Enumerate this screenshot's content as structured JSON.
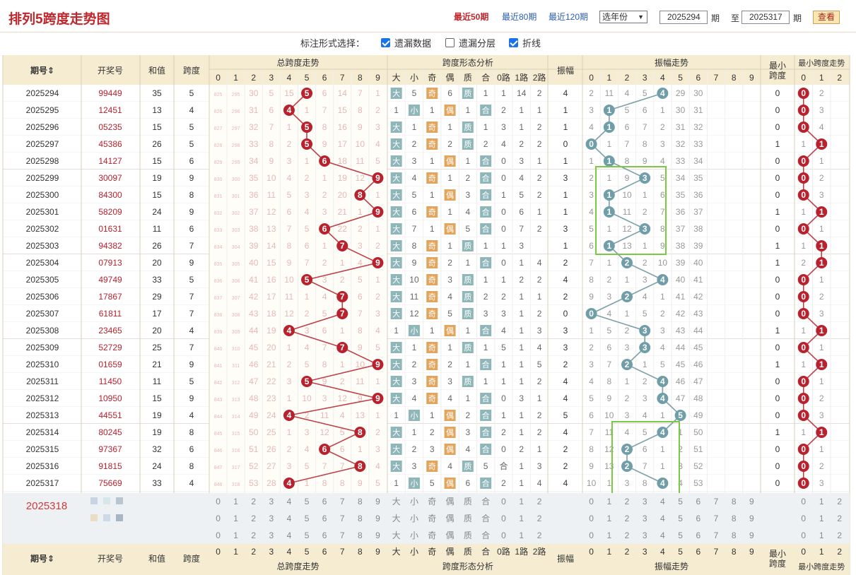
{
  "header": {
    "title": "排列5跨度走势图",
    "ranges": [
      {
        "label": "最近50期",
        "active": true
      },
      {
        "label": "最近80期",
        "active": false
      },
      {
        "label": "最近120期",
        "active": false
      }
    ],
    "year_select": "选年份",
    "from_issue": "2025294",
    "period_label": "期",
    "to_label": "至",
    "to_issue": "2025317",
    "period_label2": "期",
    "search_button": "查看"
  },
  "options": {
    "label": "标注形式选择：",
    "items": [
      {
        "label": "遗漏数据",
        "checked": true
      },
      {
        "label": "遗漏分层",
        "checked": false
      },
      {
        "label": "折线",
        "checked": true
      }
    ]
  },
  "columns": {
    "issue": "期号",
    "draw": "开奖号",
    "sum": "和值",
    "span": "跨度",
    "span_trend": "总跨度走势",
    "form": "跨度形态分析",
    "amp": "振幅",
    "amp_trend": "振幅走势",
    "minspan": "最小跨度",
    "minspan_trend": "最小跨度走势",
    "digits": [
      "0",
      "1",
      "2",
      "3",
      "4",
      "5",
      "6",
      "7",
      "8",
      "9"
    ],
    "form_sub": [
      "大",
      "小",
      "奇",
      "偶",
      "质",
      "合",
      "0路",
      "1路",
      "2路"
    ],
    "min_digits": [
      "0",
      "1",
      "2"
    ]
  },
  "rows": [
    {
      "issue": "2025294",
      "draw": "99449",
      "sum": 35,
      "span": 5,
      "amp": 4,
      "min": 0,
      "miss": [
        "825",
        "295",
        "30",
        "5",
        "15",
        "5",
        "6",
        "14",
        "7",
        "1"
      ],
      "form": [
        "大",
        "5",
        "奇",
        "6",
        "质",
        "1",
        "1",
        "14",
        "2"
      ],
      "ampMiss": [
        "2",
        "11",
        "4",
        "5",
        "4",
        "29",
        "30",
        "",
        "",
        ""
      ],
      "minMiss": [
        "0",
        "2",
        ""
      ]
    },
    {
      "issue": "2025295",
      "draw": "12451",
      "sum": 13,
      "span": 4,
      "amp": 1,
      "min": 0,
      "miss": [
        "826",
        "296",
        "31",
        "6",
        "4",
        "1",
        "7",
        "15",
        "8",
        "2"
      ],
      "form": [
        "1",
        "小",
        "1",
        "偶",
        "1",
        "合",
        "2",
        "1",
        "1"
      ],
      "ampMiss": [
        "3",
        "1",
        "5",
        "6",
        "1",
        "30",
        "31",
        "",
        "",
        ""
      ],
      "minMiss": [
        "0",
        "3",
        ""
      ]
    },
    {
      "issue": "2025296",
      "draw": "05235",
      "sum": 15,
      "span": 5,
      "amp": 1,
      "min": 0,
      "miss": [
        "827",
        "297",
        "32",
        "7",
        "1",
        "5",
        "8",
        "16",
        "9",
        "3"
      ],
      "form": [
        "大",
        "1",
        "奇",
        "1",
        "质",
        "1",
        "3",
        "1",
        "2"
      ],
      "ampMiss": [
        "4",
        "1",
        "6",
        "7",
        "2",
        "31",
        "32",
        "",
        "",
        ""
      ],
      "minMiss": [
        "0",
        "4",
        ""
      ]
    },
    {
      "issue": "2025297",
      "draw": "45386",
      "sum": 26,
      "span": 5,
      "amp": 0,
      "min": 1,
      "miss": [
        "828",
        "298",
        "33",
        "8",
        "2",
        "5",
        "9",
        "17",
        "10",
        "4"
      ],
      "form": [
        "大",
        "2",
        "奇",
        "2",
        "质",
        "2",
        "4",
        "2",
        "2"
      ],
      "ampMiss": [
        "0",
        "1",
        "7",
        "8",
        "3",
        "32",
        "33",
        "",
        "",
        ""
      ],
      "minMiss": [
        "1",
        "1",
        ""
      ]
    },
    {
      "issue": "2025298",
      "draw": "14127",
      "sum": 15,
      "span": 6,
      "amp": 1,
      "min": 0,
      "miss": [
        "829",
        "299",
        "34",
        "9",
        "3",
        "1",
        "6",
        "18",
        "11",
        "5"
      ],
      "form": [
        "大",
        "3",
        "1",
        "偶",
        "1",
        "合",
        "0",
        "3",
        "1"
      ],
      "ampMiss": [
        "1",
        "1",
        "8",
        "9",
        "4",
        "33",
        "34",
        "",
        "",
        ""
      ],
      "minMiss": [
        "0",
        "1",
        ""
      ]
    },
    {
      "issue": "2025299",
      "draw": "30097",
      "sum": 19,
      "span": 9,
      "amp": 3,
      "min": 0,
      "miss": [
        "830",
        "300",
        "35",
        "10",
        "4",
        "2",
        "1",
        "19",
        "12",
        "9"
      ],
      "form": [
        "大",
        "4",
        "奇",
        "1",
        "2",
        "合",
        "0",
        "4",
        "2"
      ],
      "ampMiss": [
        "2",
        "1",
        "9",
        "3",
        "5",
        "34",
        "35",
        "",
        "",
        ""
      ],
      "minMiss": [
        "0",
        "2",
        ""
      ]
    },
    {
      "issue": "2025300",
      "draw": "84300",
      "sum": 15,
      "span": 8,
      "amp": 1,
      "min": 0,
      "miss": [
        "831",
        "301",
        "36",
        "11",
        "5",
        "3",
        "2",
        "20",
        "8",
        "1"
      ],
      "form": [
        "大",
        "5",
        "1",
        "偶",
        "3",
        "合",
        "1",
        "5",
        "2"
      ],
      "ampMiss": [
        "3",
        "1",
        "10",
        "1",
        "6",
        "35",
        "36",
        "",
        "",
        ""
      ],
      "minMiss": [
        "0",
        "3",
        ""
      ]
    },
    {
      "issue": "2025301",
      "draw": "58209",
      "sum": 24,
      "span": 9,
      "amp": 1,
      "min": 1,
      "miss": [
        "832",
        "302",
        "37",
        "12",
        "6",
        "4",
        "3",
        "21",
        "1",
        "9"
      ],
      "form": [
        "大",
        "6",
        "奇",
        "1",
        "4",
        "合",
        "0",
        "6",
        "1"
      ],
      "ampMiss": [
        "4",
        "1",
        "11",
        "2",
        "7",
        "36",
        "37",
        "",
        "",
        ""
      ],
      "minMiss": [
        "1",
        "1",
        ""
      ]
    },
    {
      "issue": "2025302",
      "draw": "01631",
      "sum": 11,
      "span": 6,
      "amp": 3,
      "min": 0,
      "miss": [
        "833",
        "303",
        "38",
        "13",
        "7",
        "5",
        "6",
        "22",
        "2",
        "1"
      ],
      "form": [
        "大",
        "7",
        "1",
        "偶",
        "5",
        "合",
        "0",
        "7",
        "2"
      ],
      "ampMiss": [
        "5",
        "1",
        "12",
        "3",
        "8",
        "37",
        "38",
        "",
        "",
        ""
      ],
      "minMiss": [
        "0",
        "1",
        ""
      ]
    },
    {
      "issue": "2025303",
      "draw": "94382",
      "sum": 26,
      "span": 7,
      "amp": 1,
      "min": 1,
      "miss": [
        "834",
        "304",
        "39",
        "14",
        "8",
        "6",
        "1",
        "7",
        "3",
        "2"
      ],
      "form": [
        "大",
        "8",
        "奇",
        "1",
        "质",
        "1",
        "1",
        "3",
        ""
      ],
      "ampMiss": [
        "6",
        "1",
        "13",
        "1",
        "9",
        "38",
        "39",
        "",
        "",
        ""
      ],
      "minMiss": [
        "1",
        "1",
        ""
      ]
    },
    {
      "issue": "2025304",
      "draw": "07913",
      "sum": 20,
      "span": 9,
      "amp": 2,
      "min": 1,
      "miss": [
        "835",
        "305",
        "40",
        "15",
        "9",
        "7",
        "2",
        "1",
        "4",
        "9"
      ],
      "form": [
        "大",
        "9",
        "奇",
        "2",
        "1",
        "合",
        "0",
        "1",
        "4"
      ],
      "ampMiss": [
        "7",
        "1",
        "2",
        "2",
        "10",
        "39",
        "40",
        "",
        "",
        ""
      ],
      "minMiss": [
        "2",
        "1",
        ""
      ]
    },
    {
      "issue": "2025305",
      "draw": "49749",
      "sum": 33,
      "span": 5,
      "amp": 4,
      "min": 0,
      "miss": [
        "836",
        "306",
        "41",
        "16",
        "10",
        "5",
        "3",
        "2",
        "5",
        "1"
      ],
      "form": [
        "大",
        "10",
        "奇",
        "3",
        "质",
        "1",
        "1",
        "2",
        "2"
      ],
      "ampMiss": [
        "8",
        "2",
        "1",
        "3",
        "4",
        "40",
        "41",
        "",
        "",
        ""
      ],
      "minMiss": [
        "0",
        "1",
        ""
      ]
    },
    {
      "issue": "2025306",
      "draw": "17867",
      "sum": 29,
      "span": 7,
      "amp": 2,
      "min": 0,
      "miss": [
        "837",
        "307",
        "42",
        "17",
        "11",
        "1",
        "4",
        "7",
        "6",
        "2"
      ],
      "form": [
        "大",
        "11",
        "奇",
        "4",
        "质",
        "2",
        "2",
        "1",
        "1"
      ],
      "ampMiss": [
        "9",
        "3",
        "2",
        "4",
        "1",
        "41",
        "42",
        "",
        "",
        ""
      ],
      "minMiss": [
        "0",
        "2",
        ""
      ]
    },
    {
      "issue": "2025307",
      "draw": "61811",
      "sum": 17,
      "span": 7,
      "amp": 0,
      "min": 0,
      "miss": [
        "838",
        "308",
        "43",
        "18",
        "12",
        "2",
        "5",
        "7",
        "7",
        "3"
      ],
      "form": [
        "大",
        "12",
        "奇",
        "5",
        "质",
        "3",
        "3",
        "1",
        "2"
      ],
      "ampMiss": [
        "0",
        "4",
        "1",
        "5",
        "2",
        "42",
        "43",
        "",
        "",
        ""
      ],
      "minMiss": [
        "0",
        "3",
        ""
      ]
    },
    {
      "issue": "2025308",
      "draw": "23465",
      "sum": 20,
      "span": 4,
      "amp": 3,
      "min": 1,
      "miss": [
        "839",
        "309",
        "44",
        "19",
        "4",
        "3",
        "6",
        "1",
        "8",
        "4"
      ],
      "form": [
        "1",
        "小",
        "1",
        "偶",
        "1",
        "合",
        "4",
        "1",
        "3"
      ],
      "ampMiss": [
        "1",
        "5",
        "2",
        "3",
        "3",
        "43",
        "44",
        "",
        "",
        ""
      ],
      "minMiss": [
        "1",
        "1",
        ""
      ]
    },
    {
      "issue": "2025309",
      "draw": "52729",
      "sum": 25,
      "span": 7,
      "amp": 3,
      "min": 0,
      "miss": [
        "840",
        "310",
        "45",
        "20",
        "1",
        "4",
        "7",
        "7",
        "9",
        "5"
      ],
      "form": [
        "大",
        "1",
        "奇",
        "1",
        "质",
        "1",
        "5",
        "1",
        "4"
      ],
      "ampMiss": [
        "2",
        "6",
        "3",
        "3",
        "4",
        "44",
        "45",
        "",
        "",
        ""
      ],
      "minMiss": [
        "0",
        "1",
        ""
      ]
    },
    {
      "issue": "2025310",
      "draw": "01659",
      "sum": 21,
      "span": 9,
      "amp": 2,
      "min": 1,
      "miss": [
        "841",
        "311",
        "46",
        "21",
        "2",
        "5",
        "8",
        "1",
        "10",
        "9"
      ],
      "form": [
        "大",
        "2",
        "奇",
        "2",
        "1",
        "合",
        "1",
        "1",
        "5"
      ],
      "ampMiss": [
        "3",
        "7",
        "2",
        "1",
        "5",
        "45",
        "46",
        "",
        "",
        ""
      ],
      "minMiss": [
        "1",
        "1",
        ""
      ]
    },
    {
      "issue": "2025311",
      "draw": "11450",
      "sum": 11,
      "span": 5,
      "amp": 4,
      "min": 0,
      "miss": [
        "842",
        "312",
        "47",
        "22",
        "3",
        "5",
        "9",
        "2",
        "11",
        "1"
      ],
      "form": [
        "大",
        "3",
        "奇",
        "3",
        "质",
        "1",
        "1",
        "1",
        "2"
      ],
      "ampMiss": [
        "4",
        "8",
        "1",
        "2",
        "4",
        "46",
        "47",
        "",
        "",
        ""
      ],
      "minMiss": [
        "0",
        "1",
        ""
      ]
    },
    {
      "issue": "2025312",
      "draw": "10950",
      "sum": 15,
      "span": 9,
      "amp": 4,
      "min": 0,
      "miss": [
        "843",
        "313",
        "48",
        "23",
        "1",
        "10",
        "3",
        "12",
        "9"
      ],
      "form": [
        "大",
        "4",
        "奇",
        "4",
        "1",
        "合",
        "0",
        "3",
        "1"
      ],
      "ampMiss": [
        "5",
        "9",
        "2",
        "3",
        "4",
        "47",
        "48",
        "",
        "",
        ""
      ],
      "minMiss": [
        "0",
        "2",
        ""
      ]
    },
    {
      "issue": "2025313",
      "draw": "44551",
      "sum": 19,
      "span": 4,
      "amp": 5,
      "min": 0,
      "miss": [
        "844",
        "314",
        "49",
        "24",
        "4",
        "2",
        "11",
        "4",
        "13",
        "1"
      ],
      "form": [
        "1",
        "小",
        "1",
        "偶",
        "2",
        "合",
        "1",
        "1",
        "2"
      ],
      "ampMiss": [
        "6",
        "10",
        "3",
        "4",
        "1",
        "5",
        "49",
        "",
        "",
        ""
      ],
      "minMiss": [
        "0",
        "3",
        ""
      ]
    },
    {
      "issue": "2025314",
      "draw": "80245",
      "sum": 19,
      "span": 8,
      "amp": 4,
      "min": 1,
      "miss": [
        "845",
        "315",
        "50",
        "25",
        "1",
        "3",
        "12",
        "5",
        "8",
        "2"
      ],
      "form": [
        "大",
        "1",
        "2",
        "偶",
        "3",
        "合",
        "2",
        "1",
        "2"
      ],
      "ampMiss": [
        "7",
        "11",
        "4",
        "5",
        "4",
        "1",
        "50",
        "",
        "",
        ""
      ],
      "minMiss": [
        "1",
        "1",
        ""
      ]
    },
    {
      "issue": "2025315",
      "draw": "97367",
      "sum": 32,
      "span": 6,
      "amp": 2,
      "min": 0,
      "miss": [
        "846",
        "316",
        "51",
        "26",
        "2",
        "4",
        "6",
        "6",
        "1",
        "3"
      ],
      "form": [
        "大",
        "2",
        "3",
        "偶",
        "4",
        "合",
        "0",
        "2",
        "1"
      ],
      "ampMiss": [
        "8",
        "12",
        "2",
        "6",
        "1",
        "2",
        "51",
        "",
        "",
        ""
      ],
      "minMiss": [
        "0",
        "1",
        ""
      ]
    },
    {
      "issue": "2025316",
      "draw": "91815",
      "sum": 24,
      "span": 8,
      "amp": 2,
      "min": 0,
      "miss": [
        "847",
        "317",
        "52",
        "27",
        "3",
        "5",
        "7",
        "7",
        "8",
        "4"
      ],
      "form": [
        "大",
        "3",
        "奇",
        "4",
        "质",
        "5",
        "合",
        "1",
        "3",
        "2"
      ],
      "ampMiss": [
        "9",
        "13",
        "2",
        "7",
        "1",
        "3",
        "52",
        "",
        "",
        ""
      ],
      "minMiss": [
        "0",
        "2",
        ""
      ]
    },
    {
      "issue": "2025317",
      "draw": "75669",
      "sum": 33,
      "span": 4,
      "amp": 4,
      "min": 0,
      "miss": [
        "848",
        "318",
        "53",
        "28",
        "4",
        "1",
        "8",
        "8",
        "9",
        "5"
      ],
      "form": [
        "1",
        "小",
        "5",
        "偶",
        "6",
        "合",
        "2",
        "1",
        "4"
      ],
      "ampMiss": [
        "10",
        "1",
        "3",
        "8",
        "4",
        "4",
        "53",
        "",
        "",
        ""
      ],
      "minMiss": [
        "0",
        "3",
        ""
      ]
    }
  ],
  "next_issue": "2025318",
  "select_rows": [
    [
      "0",
      "1",
      "2",
      "3",
      "4",
      "5",
      "6",
      "7",
      "8",
      "9"
    ],
    [
      "0",
      "1",
      "2",
      "3",
      "4",
      "5",
      "6",
      "7",
      "8",
      "9"
    ],
    [
      "0",
      "1",
      "2",
      "3",
      "4",
      "5",
      "6",
      "7",
      "8",
      "9"
    ]
  ],
  "select_form": [
    "大",
    "小",
    "奇",
    "偶",
    "质",
    "合",
    "0",
    "1",
    "2"
  ],
  "colors": {
    "header_bg": "#f6ecd2",
    "red_ball": "#b7222e",
    "teal_ball": "#6f9ea8",
    "form_box": "#8fb7b9",
    "orange_box": "#e2a55e",
    "line_red": "#c0404a",
    "line_teal": "#7aa0a8"
  }
}
